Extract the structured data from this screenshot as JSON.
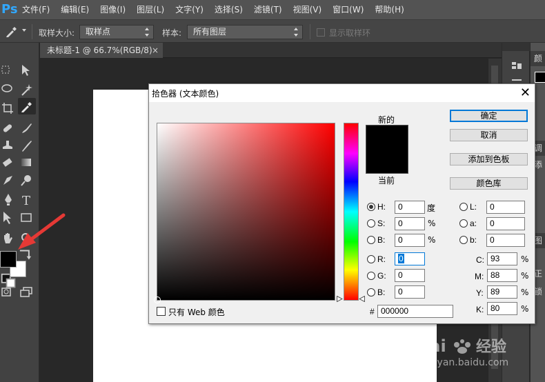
{
  "app": {
    "logo": "Ps"
  },
  "menu": [
    "文件(F)",
    "编辑(E)",
    "图像(I)",
    "图层(L)",
    "文字(Y)",
    "选择(S)",
    "滤镜(T)",
    "视图(V)",
    "窗口(W)",
    "帮助(H)"
  ],
  "options_bar": {
    "sample_size_label": "取样大小:",
    "sample_size_value": "取样点",
    "sample_label": "样本:",
    "sample_value": "所有图层",
    "show_ring_label": "显示取样环"
  },
  "document": {
    "tab_title": "未标题-1 @ 66.7%(RGB/8)",
    "close_glyph": "×"
  },
  "right_panels": {
    "top_label": "颜",
    "tabs": [
      "调",
      "添",
      "图",
      "正",
      "锁"
    ]
  },
  "watermark": {
    "logo": "Bai度经验",
    "url": "jingyan.baidu.com"
  },
  "colors": {
    "foreground": "#000000",
    "background": "#ffffff",
    "arrow": "#e53935",
    "accent": "#0078d7"
  },
  "dialog": {
    "title": "拾色器 (文本颜色)",
    "close_glyph": "✕",
    "new_label": "新的",
    "current_label": "当前",
    "buttons": {
      "ok": "确定",
      "cancel": "取消",
      "add_to_swatches": "添加到色板",
      "color_libraries": "颜色库"
    },
    "web_only_label": "只有 Web 颜色",
    "fields": {
      "H": {
        "label": "H:",
        "value": "0",
        "unit": "度"
      },
      "S": {
        "label": "S:",
        "value": "0",
        "unit": "%"
      },
      "B": {
        "label": "B:",
        "value": "0",
        "unit": "%"
      },
      "R": {
        "label": "R:",
        "value": "0"
      },
      "G": {
        "label": "G:",
        "value": "0"
      },
      "Bv": {
        "label": "B:",
        "value": "0"
      },
      "L": {
        "label": "L:",
        "value": "0"
      },
      "a": {
        "label": "a:",
        "value": "0"
      },
      "b": {
        "label": "b:",
        "value": "0"
      },
      "C": {
        "label": "C:",
        "value": "93",
        "unit": "%"
      },
      "M": {
        "label": "M:",
        "value": "88",
        "unit": "%"
      },
      "Y": {
        "label": "Y:",
        "value": "89",
        "unit": "%"
      },
      "K": {
        "label": "K:",
        "value": "80",
        "unit": "%"
      }
    },
    "hex": {
      "label": "#",
      "value": "000000"
    },
    "selected_radio": "H"
  }
}
